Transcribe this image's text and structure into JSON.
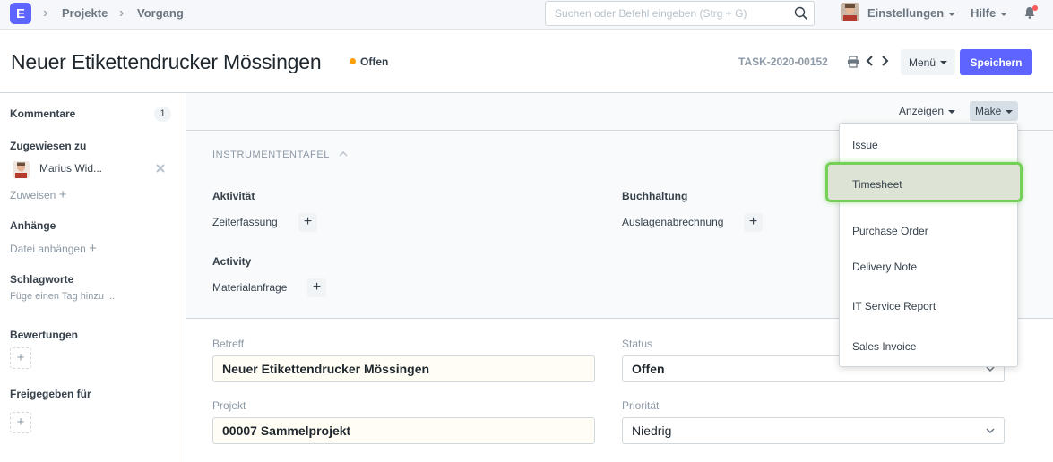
{
  "navbar": {
    "logo": "E",
    "breadcrumbs": [
      "Projekte",
      "Vorgang"
    ],
    "search_placeholder": "Suchen oder Befehl eingeben (Strg + G)",
    "settings": "Einstellungen",
    "help": "Hilfe"
  },
  "page": {
    "title": "Neuer Etikettendrucker Mössingen",
    "status": "Offen",
    "status_color": "#ffa00a",
    "doc_name": "TASK-2020-00152",
    "menu_button": "Menü",
    "save_button": "Speichern"
  },
  "sidebar": {
    "comments_label": "Kommentare",
    "comments_count": "1",
    "assigned_label": "Zugewiesen zu",
    "assignee": "Marius Wid...",
    "assign_link": "Zuweisen",
    "attachments_label": "Anhänge",
    "attach_link": "Datei anhängen",
    "tags_label": "Schlagworte",
    "tags_placeholder": "Füge einen Tag hinzu ...",
    "ratings_label": "Bewertungen",
    "shared_label": "Freigegeben für"
  },
  "toolbar": {
    "show": "Anzeigen",
    "make": "Make"
  },
  "dashboard": {
    "title": "INSTRUMENTENTAFEL",
    "groups": [
      {
        "title": "Aktivität",
        "items": [
          "Zeiterfassung"
        ]
      },
      {
        "title": "Buchhaltung",
        "items": [
          "Auslagenabrechnung"
        ]
      },
      {
        "title": "Activity",
        "items": [
          "Materialanfrage"
        ]
      }
    ]
  },
  "form": {
    "subject_label": "Betreff",
    "subject_value": "Neuer Etikettendrucker Mössingen",
    "status_label": "Status",
    "status_value": "Offen",
    "project_label": "Projekt",
    "project_value": "00007 Sammelprojekt",
    "priority_label": "Priorität",
    "priority_value": "Niedrig"
  },
  "make_menu": {
    "items": [
      "Issue",
      "Timesheet",
      "Purchase Order",
      "Delivery Note",
      "IT Service Report",
      "Sales Invoice"
    ],
    "highlighted": "Timesheet",
    "highlight_color": "#74d057"
  },
  "colors": {
    "accent": "#5e64ff",
    "navbar_bg": "#f5f7fa"
  }
}
